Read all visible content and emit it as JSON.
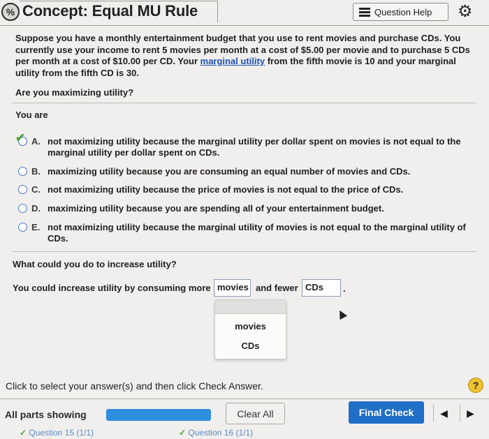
{
  "header": {
    "title": "Concept: Equal MU Rule",
    "help_label": "Question Help",
    "concept_icon": "percent-icon",
    "settings_icon": "gear-icon"
  },
  "problem": {
    "text_before_link": "Suppose you have a monthly entertainment budget that you use to rent movies and purchase CDs. You currently use your income to rent 5 movies per month at a cost of $5.00 per movie and to purchase 5 CDs per month at a cost of $10.00 per CD. Your ",
    "link_text": "marginal utility",
    "text_after_link": " from the fifth movie is 10 and your marginal utility from the fifth CD is 30."
  },
  "question1": {
    "prompt": "Are you maximizing utility?",
    "stem": "You are",
    "options": [
      {
        "letter": "A.",
        "text": "not maximizing utility because the marginal utility per dollar spent on movies is not equal to the marginal utility per dollar spent on CDs.",
        "selected": true
      },
      {
        "letter": "B.",
        "text": "maximizing utility because you are consuming an equal number of movies and CDs.",
        "selected": false
      },
      {
        "letter": "C.",
        "text": "not maximizing utility because the price of movies is not equal to the price of CDs.",
        "selected": false
      },
      {
        "letter": "D.",
        "text": "maximizing utility because you are spending all of your entertainment budget.",
        "selected": false
      },
      {
        "letter": "E.",
        "text": "not maximizing utility because the marginal utility of movies is not equal to the marginal utility of CDs.",
        "selected": false
      }
    ]
  },
  "question2": {
    "prompt": "What could you do to increase utility?",
    "sentence_start": "You could increase utility by consuming more",
    "sentence_mid": "and fewer",
    "sentence_end": ".",
    "dropdown1_value": "movies",
    "dropdown2_value": "CDs",
    "dropdown_options": [
      "movies",
      "CDs"
    ]
  },
  "footer": {
    "instruction": "Click to select your answer(s) and then click Check Answer.",
    "help_glyph": "?",
    "all_parts": "All parts showing",
    "progress_fraction": 1.0,
    "clear_label": "Clear All",
    "final_label": "Final Check",
    "prev_glyph": "◀",
    "next_glyph": "▶",
    "question_status": [
      {
        "check": "✓",
        "label": "Question 15 (1/1)"
      },
      {
        "check": "✓",
        "label": "Question 16 (1/1)"
      }
    ]
  },
  "colors": {
    "link": "#1d4fb6",
    "final_button": "#1f6fc7",
    "progress": "#2f8de0",
    "check": "#4ba33b",
    "help_circle": "#f0c230"
  }
}
